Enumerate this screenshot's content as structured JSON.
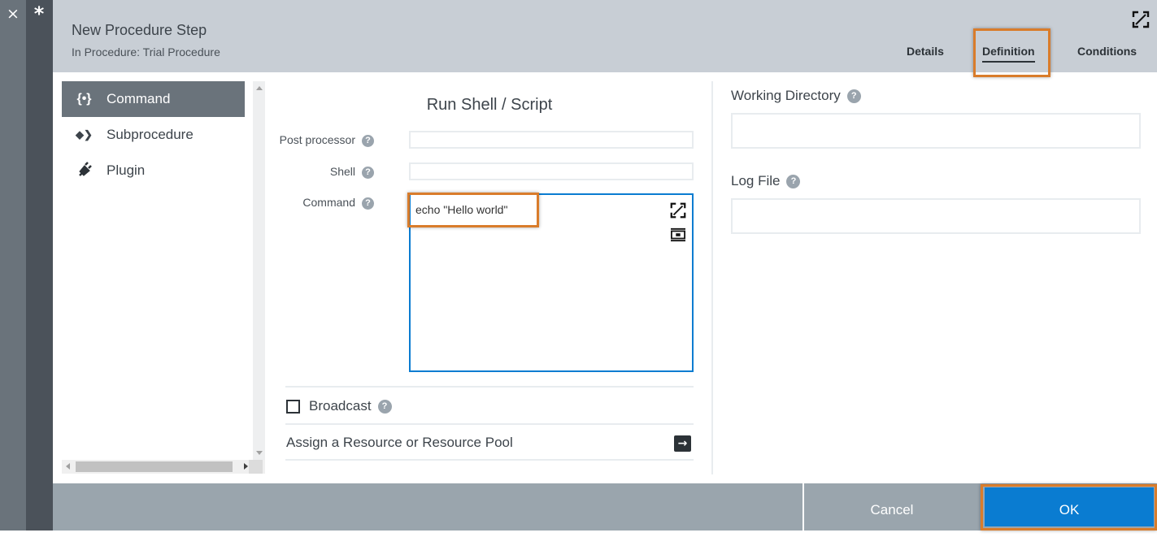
{
  "rail": {
    "close_glyph": "×",
    "pin_glyph": "*"
  },
  "header": {
    "title": "New Procedure Step",
    "subtitle": "In Procedure: Trial Procedure",
    "tabs": [
      {
        "label": "Details",
        "active": false
      },
      {
        "label": "Definition",
        "active": true
      },
      {
        "label": "Conditions",
        "active": false
      }
    ]
  },
  "sidebar": {
    "items": [
      {
        "label": "Command",
        "icon": "command-braces-icon",
        "glyph": "{•}",
        "active": true
      },
      {
        "label": "Subprocedure",
        "icon": "subprocedure-diamond-icon",
        "glyph": "◆❯",
        "active": false
      },
      {
        "label": "Plugin",
        "icon": "plug-icon",
        "glyph": "🔌",
        "active": false
      }
    ]
  },
  "form": {
    "section_title": "Run Shell / Script",
    "post_processor": {
      "label": "Post processor",
      "value": ""
    },
    "shell": {
      "label": "Shell",
      "value": ""
    },
    "command": {
      "label": "Command",
      "value": "echo \"Hello world\""
    },
    "broadcast": {
      "label": "Broadcast",
      "checked": false
    },
    "assign_resource": {
      "label": "Assign a Resource or Resource Pool"
    }
  },
  "right": {
    "working_directory": {
      "label": "Working Directory",
      "value": ""
    },
    "log_file": {
      "label": "Log File",
      "value": ""
    }
  },
  "footer": {
    "cancel_label": "Cancel",
    "ok_label": "OK"
  },
  "colors": {
    "accent": "#0a7cd1",
    "highlight": "#d97c2b",
    "header_bg": "#c8ced5",
    "footer_bg": "#9aa5ad"
  }
}
